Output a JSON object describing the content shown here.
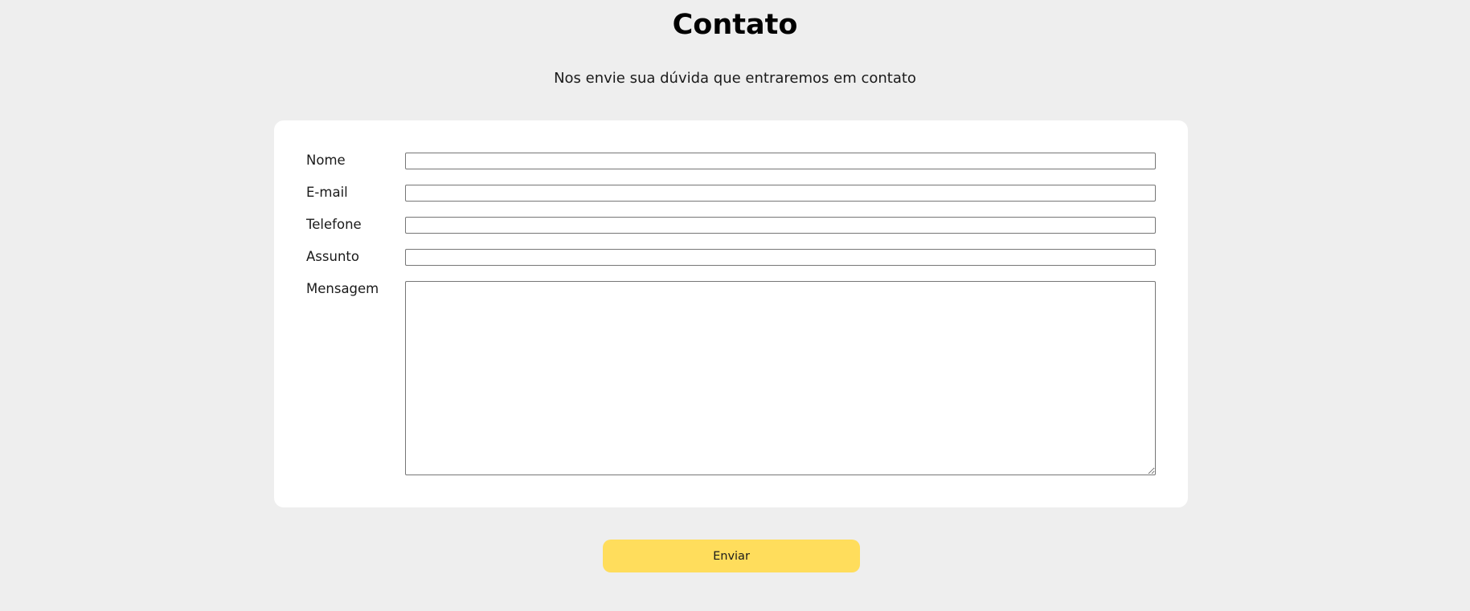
{
  "page": {
    "title": "Contato",
    "subtitle": "Nos envie sua dúvida que entraremos em contato"
  },
  "form": {
    "fields": [
      {
        "label": "Nome",
        "value": ""
      },
      {
        "label": "E-mail",
        "value": ""
      },
      {
        "label": "Telefone",
        "value": ""
      },
      {
        "label": "Assunto",
        "value": ""
      },
      {
        "label": "Mensagem",
        "value": ""
      }
    ],
    "submit_label": "Enviar"
  },
  "colors": {
    "background": "#eeeeee",
    "card": "#ffffff",
    "button": "#ffdd5c"
  }
}
